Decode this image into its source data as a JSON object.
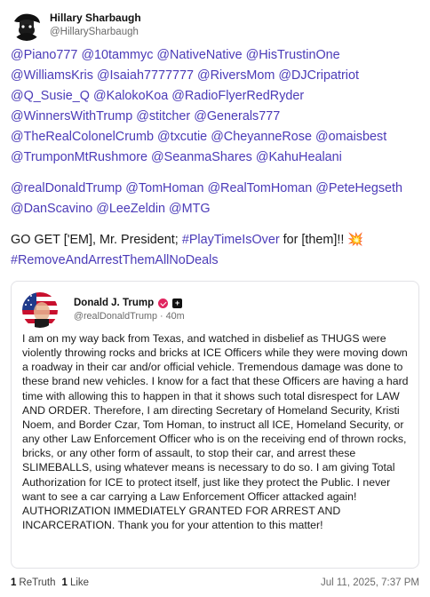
{
  "author": {
    "name": "Hillary Sharbaugh",
    "handle": "@HillarySharbaugh"
  },
  "mentions_block_1": [
    [
      "@Piano777",
      "@10tammyc",
      "@NativeNative",
      "@HisTrustinOne"
    ],
    [
      "@WilliamsKris",
      "@Isaiah7777777",
      "@RiversMom",
      "@DJCripatriot"
    ],
    [
      "@Q_Susie_Q",
      "@KalokoKoa",
      "@RadioFlyerRedRyder"
    ],
    [
      "@WinnersWithTrump",
      "@stitcher",
      "@Generals777"
    ],
    [
      "@TheRealColonelCrumb",
      "@txcutie",
      "@CheyanneRose",
      "@omaisbest"
    ],
    [
      "@TrumponMtRushmore",
      "@SeanmaShares",
      "@KahuHealani"
    ]
  ],
  "mentions_block_2": [
    [
      "@realDonaldTrump",
      "@TomHoman",
      "@RealTomHoman",
      "@PeteHegseth"
    ],
    [
      "@DanScavino",
      " @LeeZeldin",
      "@MTG"
    ]
  ],
  "message": {
    "text_before": "GO GET ['EM], Mr. President; ",
    "hashtag_1": "#PlayTimeIsOver",
    "text_after": " for [them]!! ",
    "emoji": "💥",
    "hashtag_2": "#RemoveAndArrestThemAllNoDeals"
  },
  "quoted_post": {
    "name": "Donald J. Trump",
    "handle": "@realDonaldTrump",
    "time": "40m",
    "text": "I am on my way back from Texas, and watched in disbelief as THUGS were violently throwing rocks and bricks at ICE Officers while they were moving down a roadway in their car and/or official vehicle. Tremendous damage was done to these brand new vehicles. I know for a fact that these Officers are having a hard time with allowing this to happen in that it shows such total disrespect for LAW AND ORDER. Therefore, I am directing Secretary of Homeland Security, Kristi Noem, and Border Czar, Tom Homan, to instruct all ICE, Homeland Security, or any other Law Enforcement Officer who is on the receiving end of thrown rocks, bricks, or any other form of assault, to stop their car, and arrest these SLIMEBALLS, using whatever means is necessary to do so. I am giving Total Authorization for ICE to protect itself, just like they protect the Public. I never want to see a car carrying a Law Enforcement Officer attacked again! AUTHORIZATION IMMEDIATELY GRANTED FOR ARREST AND INCARCERATION. Thank you for your attention to this matter!",
    "verified_icon": "verified-badge-icon",
    "plus_icon": "plus-badge-icon",
    "plus_glyph": "+"
  },
  "stats": {
    "retruths_count": "1",
    "retruths_label": "ReTruth",
    "likes_count": "1",
    "likes_label": "Like"
  },
  "timestamp": "Jul 11, 2025, 7:37 PM",
  "colors": {
    "mention": "#4b3bb8",
    "verified": "#e0245e",
    "border": "#e2e2e6",
    "muted": "#6b6b6b"
  }
}
